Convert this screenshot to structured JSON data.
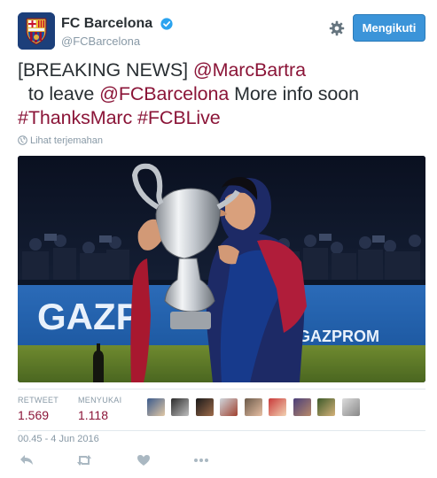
{
  "header": {
    "display_name": "FC Barcelona",
    "handle": "@FCBarcelona",
    "follow_label": "Mengikuti",
    "verified_icon": "verified-badge-icon",
    "settings_icon": "gear-icon"
  },
  "tweet": {
    "prefix": "[BREAKING NEWS] ",
    "mention1": "@MarcBartra",
    "middle1": "  to leave ",
    "mention2": "@FCBarcelona",
    "middle2": " More info soon ",
    "hashtag1": "#ThanksMarc",
    "space": " ",
    "hashtag2": "#FCBLive",
    "translate_label": "Lihat terjemahan",
    "link_color": "#8b1538"
  },
  "media": {
    "banner_text1": "GAZP",
    "banner_text2": "GAZPROM"
  },
  "stats": {
    "retweet_label": "RETWEET",
    "retweet_count": "1.569",
    "likes_label": "MENYUKAI",
    "likes_count": "1.118"
  },
  "timestamp": "00.45 - 4 Jun 2016",
  "actions": {
    "reply_icon": "reply-icon",
    "retweet_icon": "retweet-icon",
    "like_icon": "heart-icon",
    "more_icon": "more-icon"
  },
  "colors": {
    "accent": "#3b94d9",
    "link": "#8b1538",
    "muted": "#8899a6"
  }
}
